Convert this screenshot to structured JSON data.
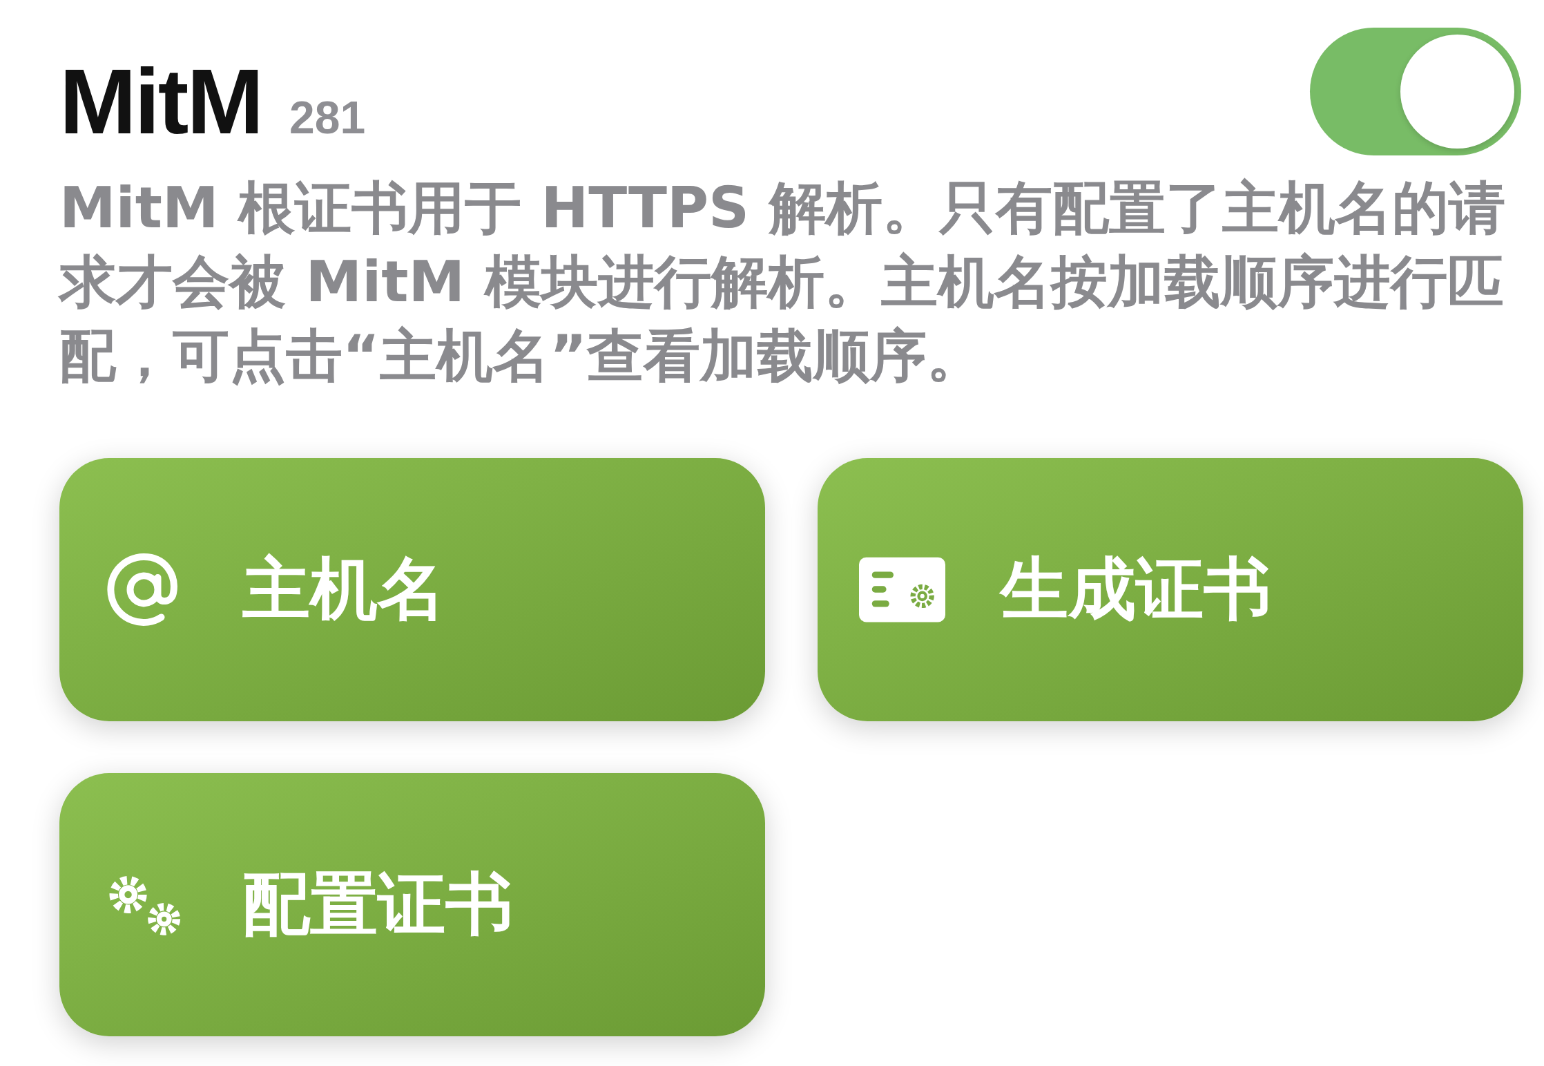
{
  "header": {
    "title": "MitM",
    "count": "281",
    "toggle": {
      "on": true
    }
  },
  "description": "MitM 根证书用于 HTTPS 解析。只有配置了主机名的请求才会被 MitM 模块进行解析。主机名按加载顺序进行匹配，可点击“主机名”查看加载顺序。",
  "buttons": [
    {
      "label": "主机名"
    },
    {
      "label": "生成证书"
    },
    {
      "label": "配置证书"
    }
  ]
}
